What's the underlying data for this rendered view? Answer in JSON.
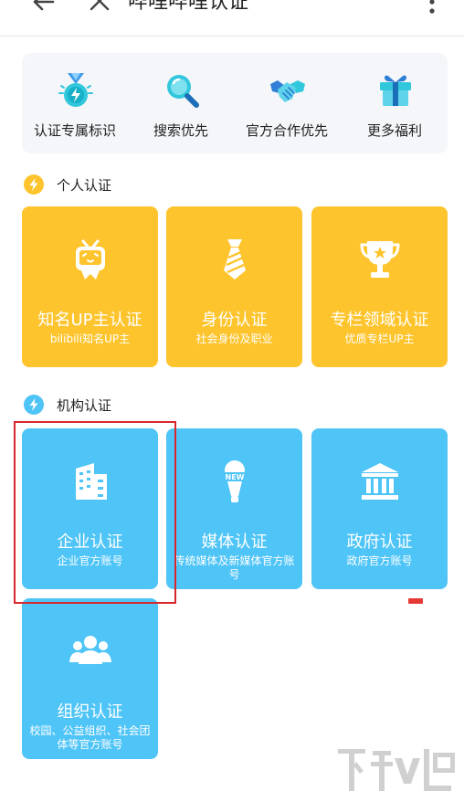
{
  "header": {
    "title": "哔哩哔哩认证",
    "back_icon": "arrow-left-icon",
    "close_icon": "close-icon",
    "more_icon": "more-vertical-icon"
  },
  "benefits": [
    {
      "label": "认证专属标识",
      "icon": "medal-icon"
    },
    {
      "label": "搜索优先",
      "icon": "magnifier-icon"
    },
    {
      "label": "官方合作优先",
      "icon": "handshake-icon"
    },
    {
      "label": "更多福利",
      "icon": "gift-icon"
    }
  ],
  "personal": {
    "heading": "个人认证",
    "cards": [
      {
        "title": "知名UP主认证",
        "subtitle": "bilibili知名UP主",
        "icon": "tv-mascot-icon"
      },
      {
        "title": "身份认证",
        "subtitle": "社会身份及职业",
        "icon": "necktie-icon"
      },
      {
        "title": "专栏领域认证",
        "subtitle": "优质专栏UP主",
        "icon": "trophy-icon"
      }
    ]
  },
  "organization": {
    "heading": "机构认证",
    "cards": [
      {
        "title": "企业认证",
        "subtitle": "企业官方账号",
        "icon": "building-icon"
      },
      {
        "title": "媒体认证",
        "subtitle": "传统媒体及新媒体官方账号",
        "icon": "microphone-icon",
        "badge": "NEW"
      },
      {
        "title": "政府认证",
        "subtitle": "政府官方账号",
        "icon": "government-icon"
      },
      {
        "title": "组织认证",
        "subtitle": "校园、公益组织、社会团体等官方账号",
        "icon": "group-icon"
      }
    ]
  },
  "colors": {
    "personal_card": "#fdc42d",
    "organization_card": "#4fc4f7",
    "section_bolt": "#fdc42d",
    "highlight_border": "#d9262c"
  }
}
